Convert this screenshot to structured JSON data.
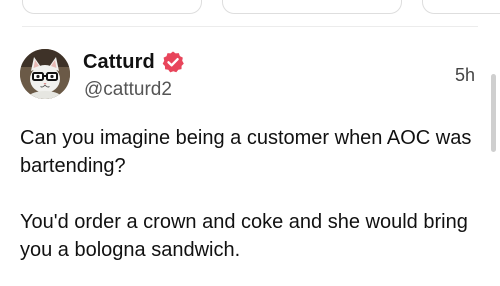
{
  "post": {
    "display_name": "Catturd",
    "handle": "@catturd2",
    "timestamp": "5h",
    "text": "Can you imagine being a customer when AOC was bartending?\n\nYou'd order a crown and coke and she would bring you a bologna sandwich.",
    "verified": true
  },
  "colors": {
    "verified_badge": "#e8455b",
    "handle_text": "#555555",
    "divider": "#ececec"
  },
  "icons": {
    "avatar": "cat-with-glasses-avatar",
    "verified": "verified-badge-icon"
  }
}
